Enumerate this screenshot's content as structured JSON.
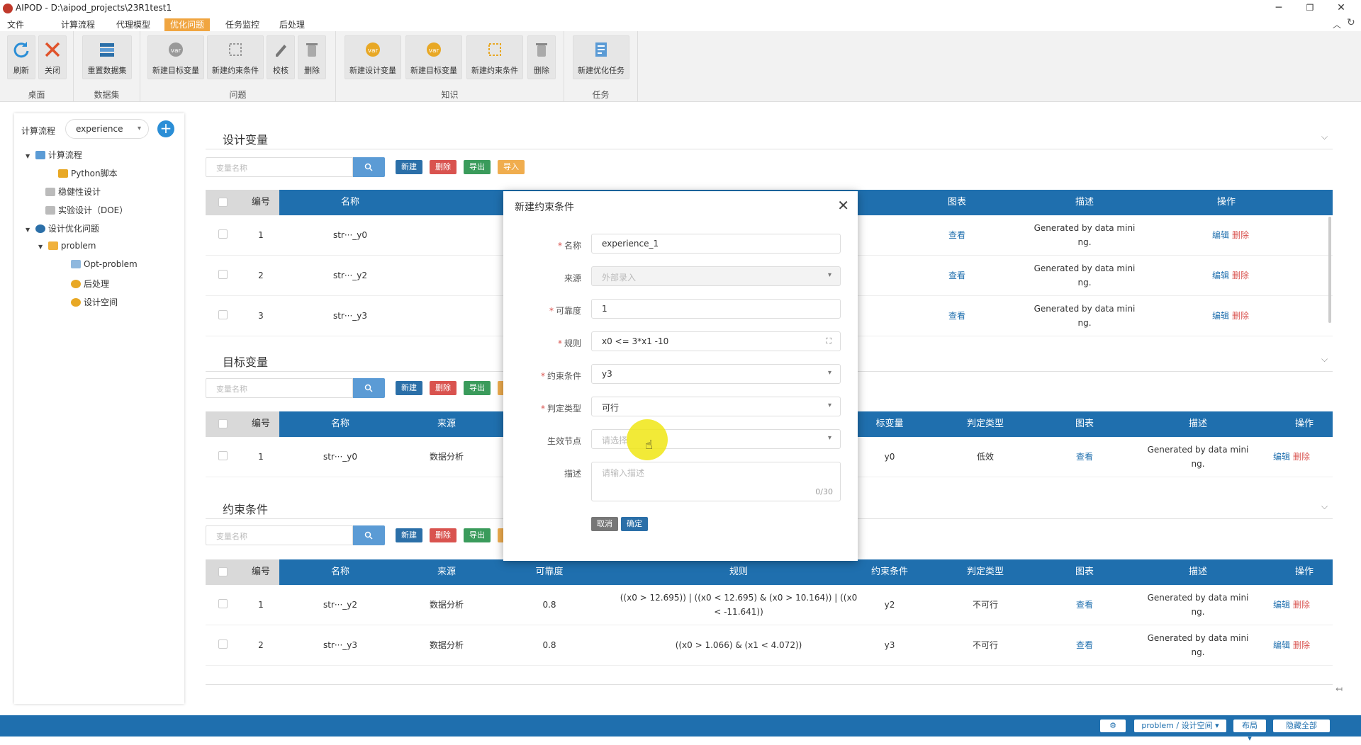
{
  "window": {
    "title": "AIPOD - D:\\aipod_projects\\23R1test1",
    "controls": [
      "─",
      "❐",
      "✕"
    ]
  },
  "menubar": {
    "items": [
      "文件",
      "计算流程",
      "代理模型",
      "优化问题",
      "任务监控",
      "后处理"
    ],
    "active_index": 3
  },
  "ribbon": {
    "groups": [
      {
        "label": "桌面",
        "buttons": [
          "刷新",
          "关闭"
        ]
      },
      {
        "label": "数据集",
        "buttons": [
          "重置数据集"
        ]
      },
      {
        "label": "问题",
        "buttons": [
          "新建目标变量",
          "新建约束条件",
          "校核",
          "删除"
        ]
      },
      {
        "label": "知识",
        "buttons": [
          "新建设计变量",
          "新建目标变量",
          "新建约束条件",
          "删除"
        ]
      },
      {
        "label": "任务",
        "buttons": [
          "新建优化任务"
        ]
      }
    ]
  },
  "left": {
    "flow_label": "计算流程",
    "flow_select": "experience",
    "tree": [
      "计算流程",
      "Python脚本",
      "稳健性设计",
      "实验设计（DOE）",
      "设计优化问题",
      "problem",
      "Opt-problem",
      "后处理",
      "设计空间"
    ]
  },
  "design_vars": {
    "title": "设计变量",
    "search_placeholder": "变量名称",
    "buttons": {
      "new": "新建",
      "delete": "删除",
      "export": "导出",
      "import": "导入"
    },
    "headers": [
      "编号",
      "名称",
      "图表",
      "描述",
      "操作"
    ],
    "rows": [
      {
        "no": "1",
        "name": "str···_y0",
        "chart": "查看",
        "desc1": "Generated by data mini",
        "desc2": "ng.",
        "edit": "编辑",
        "del": "删除"
      },
      {
        "no": "2",
        "name": "str···_y2",
        "chart": "查看",
        "desc1": "Generated by data mini",
        "desc2": "ng.",
        "edit": "编辑",
        "del": "删除"
      },
      {
        "no": "3",
        "name": "str···_y3",
        "chart": "查看",
        "desc1": "Generated by data mini",
        "desc2": "ng.",
        "edit": "编辑",
        "del": "删除"
      }
    ]
  },
  "objective_vars": {
    "title": "目标变量",
    "search_placeholder": "变量名称",
    "buttons": {
      "new": "新建",
      "delete": "删除",
      "export": "导出"
    },
    "headers": [
      "编号",
      "名称",
      "来源",
      "标变量",
      "判定类型",
      "图表",
      "描述",
      "操作"
    ],
    "rows": [
      {
        "no": "1",
        "name": "str···_y0",
        "source": "数据分析",
        "var": "y0",
        "type": "低效",
        "chart": "查看",
        "desc1": "Generated by data mini",
        "desc2": "ng.",
        "edit": "编辑",
        "del": "删除"
      }
    ]
  },
  "constraints": {
    "title": "约束条件",
    "search_placeholder": "变量名称",
    "buttons": {
      "new": "新建",
      "delete": "删除",
      "export": "导出"
    },
    "headers": [
      "编号",
      "名称",
      "来源",
      "可靠度",
      "规则",
      "约束条件",
      "判定类型",
      "图表",
      "描述",
      "操作"
    ],
    "rows": [
      {
        "no": "1",
        "name": "str···_y2",
        "source": "数据分析",
        "rel": "0.8",
        "rule1": "((x0 > 12.695)) | ((x0 < 12.695) & (x0 > 10.164)) | ((x0",
        "rule2": "< -11.641))",
        "cons": "y2",
        "type": "不可行",
        "chart": "查看",
        "desc1": "Generated by data mini",
        "desc2": "ng.",
        "edit": "编辑",
        "del": "删除"
      },
      {
        "no": "2",
        "name": "str···_y3",
        "source": "数据分析",
        "rel": "0.8",
        "rule1": "((x0 > 1.066) & (x1 < 4.072))",
        "rule2": "",
        "cons": "y3",
        "type": "不可行",
        "chart": "查看",
        "desc1": "Generated by data mini",
        "desc2": "ng.",
        "edit": "编辑",
        "del": "删除"
      }
    ]
  },
  "dialog": {
    "title": "新建约束条件",
    "fields": {
      "name": {
        "label": "名称",
        "value": "experience_1"
      },
      "source": {
        "label": "来源",
        "value": "外部录入"
      },
      "reliability": {
        "label": "可靠度",
        "value": "1"
      },
      "rule": {
        "label": "规则",
        "value": "x0 <= 3*x1 -10"
      },
      "constraint": {
        "label": "约束条件",
        "value": "y3"
      },
      "judge_type": {
        "label": "判定类型",
        "value": "可行"
      },
      "node": {
        "label": "生效节点",
        "placeholder": "请选择"
      },
      "desc": {
        "label": "描述",
        "placeholder": "请输入描述",
        "counter": "0/30"
      }
    },
    "cancel": "取消",
    "ok": "确定"
  },
  "statusbar": {
    "settings": "⚙",
    "path": "problem / 设计空间 ▾",
    "layout": "布局 ▾",
    "hide_all": "隐藏全部"
  }
}
